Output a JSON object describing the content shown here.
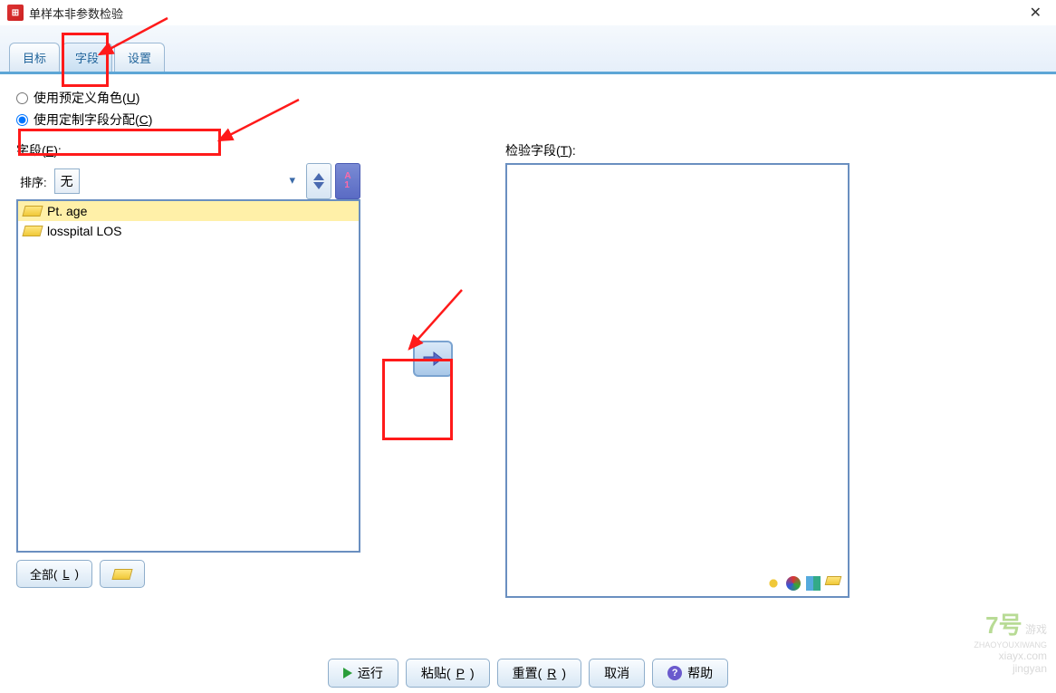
{
  "titlebar": {
    "title": "单样本非参数检验"
  },
  "tabs": {
    "target": "目标",
    "fields": "字段",
    "settings": "设置",
    "active": 1
  },
  "radios": {
    "predefined": "使用预定义角色(",
    "predefined_key": "U",
    "custom": "使用定制字段分配(",
    "custom_key": "C",
    "close_paren": ")"
  },
  "left": {
    "section": "字段(",
    "section_key": "F",
    "section_close": "):",
    "sort_label": "排序:",
    "sort_value": "无",
    "items": [
      "Pt. age",
      "losspital LOS"
    ],
    "all_btn": "全部(",
    "all_key": "L",
    "all_close": ")"
  },
  "right": {
    "section": "检验字段(",
    "section_key": "T",
    "section_close": "):"
  },
  "footer": {
    "run": "运行",
    "paste": "粘贴(",
    "paste_key": "P",
    "paste_close": ")",
    "reset": "重置(",
    "reset_key": "R",
    "reset_close": ")",
    "cancel": "取消",
    "help": "帮助"
  },
  "watermark": {
    "logo": "7号",
    "tag": "游戏",
    "sub": "ZHAOYOUXIWANG",
    "url": "xiayx.com",
    "exp": "jingyan"
  }
}
